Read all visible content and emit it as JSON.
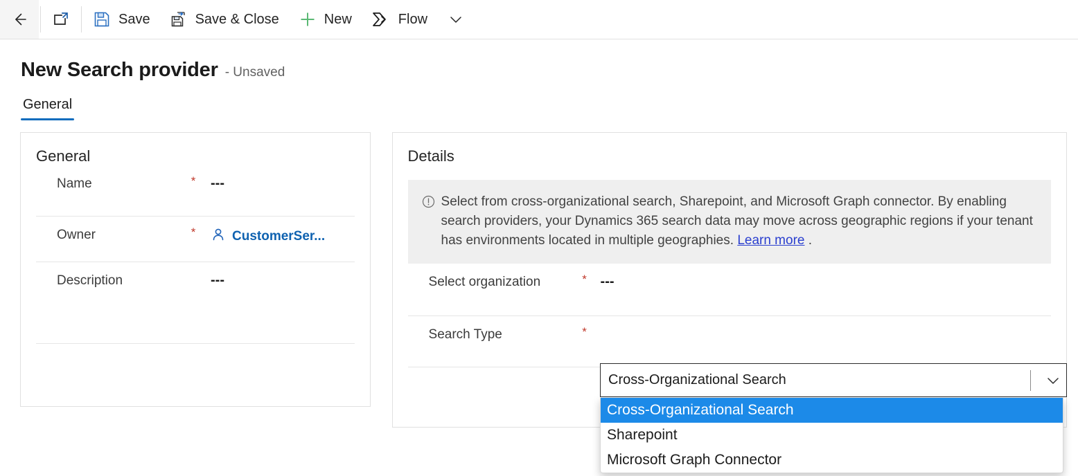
{
  "commandbar": {
    "back_tooltip": "Back",
    "popout_tooltip": "Open in new window",
    "save_label": "Save",
    "save_close_label": "Save & Close",
    "new_label": "New",
    "flow_label": "Flow",
    "overflow_label": "More commands"
  },
  "header": {
    "title": "New Search provider",
    "subtitle": "- Unsaved"
  },
  "tabs": [
    {
      "label": "General",
      "active": true
    }
  ],
  "general_card": {
    "title": "General",
    "fields": [
      {
        "label": "Name",
        "required": "*",
        "value": "---"
      },
      {
        "label": "Owner",
        "required": "*",
        "value": "CustomerSer..."
      },
      {
        "label": "Description",
        "required": "",
        "value": "---"
      }
    ]
  },
  "details_card": {
    "title": "Details",
    "info": {
      "icon": "info-circle-icon",
      "text": "Select from cross-organizational search, Sharepoint, and Microsoft Graph connector. By enabling search providers, your Dynamics 365 search data may move across geographic regions if your tenant has environments located in multiple geographies. ",
      "link_label": "Learn more",
      "trailing": " ."
    },
    "fields": [
      {
        "label": "Select organization",
        "required": "*",
        "value": "---"
      },
      {
        "label": "Search Type",
        "required": "*",
        "value": "Cross-Organizational Search"
      }
    ]
  },
  "search_type_dropdown": {
    "expanded": true,
    "selected_value": "Cross-Organizational Search",
    "options": [
      {
        "label": "Cross-Organizational Search",
        "selected": true
      },
      {
        "label": "Sharepoint",
        "selected": false
      },
      {
        "label": "Microsoft Graph Connector",
        "selected": false
      }
    ]
  },
  "colors": {
    "accent_blue": "#0f6cbd",
    "highlight_blue": "#1c8ae8",
    "link_blue": "#0f62b0",
    "required_red": "#c0392b",
    "new_green": "#5bb974",
    "info_bg": "#efefef"
  }
}
